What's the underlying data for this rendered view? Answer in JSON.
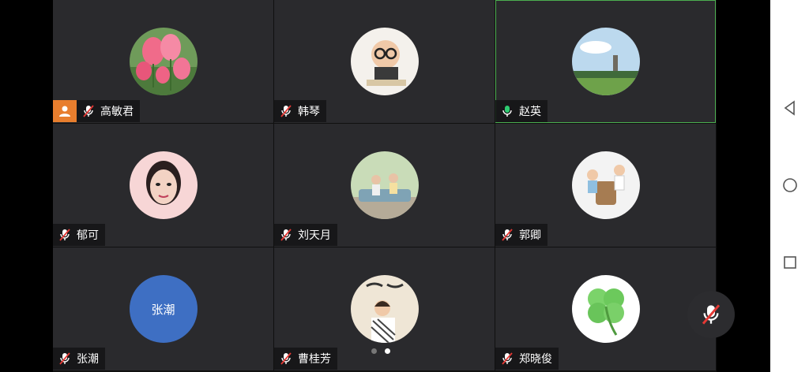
{
  "meeting": {
    "participants": [
      {
        "name": "高敏君",
        "mic": "muted",
        "host": true,
        "avatar": "tulip-flowers-photo",
        "active": false
      },
      {
        "name": "韩琴",
        "mic": "muted",
        "host": false,
        "avatar": "baby-with-glasses-photo",
        "active": false
      },
      {
        "name": "赵英",
        "mic": "on",
        "host": false,
        "avatar": "landscape-sky-photo",
        "active": true
      },
      {
        "name": "郁可",
        "mic": "muted",
        "host": false,
        "avatar": "woman-portrait-photo",
        "active": false
      },
      {
        "name": "刘天月",
        "mic": "muted",
        "host": false,
        "avatar": "children-on-sofa-photo",
        "active": false
      },
      {
        "name": "郭卿",
        "mic": "muted",
        "host": false,
        "avatar": "two-kids-photo",
        "active": false
      },
      {
        "name": "张潮",
        "mic": "muted",
        "host": false,
        "avatar_text": "张潮",
        "active": false
      },
      {
        "name": "曹桂芳",
        "mic": "muted",
        "host": false,
        "avatar": "woman-with-calligraphy-photo",
        "active": false
      },
      {
        "name": "郑晓俊",
        "mic": "muted",
        "host": false,
        "avatar": "four-leaf-clover-image",
        "active": false
      }
    ],
    "pagination": {
      "pages": 2,
      "current": 2
    },
    "floating_mic": "muted"
  },
  "colors": {
    "tile_bg": "#2a2a2d",
    "host_badge": "#e87e2e",
    "active_border": "#4caf50",
    "mic_muted": "#e53935",
    "mic_on": "#2ecc71",
    "text_avatar_bg": "#3e6fc3"
  },
  "system_nav": {
    "icons": [
      "back-triangle-icon",
      "home-circle-icon",
      "recents-square-icon"
    ]
  }
}
